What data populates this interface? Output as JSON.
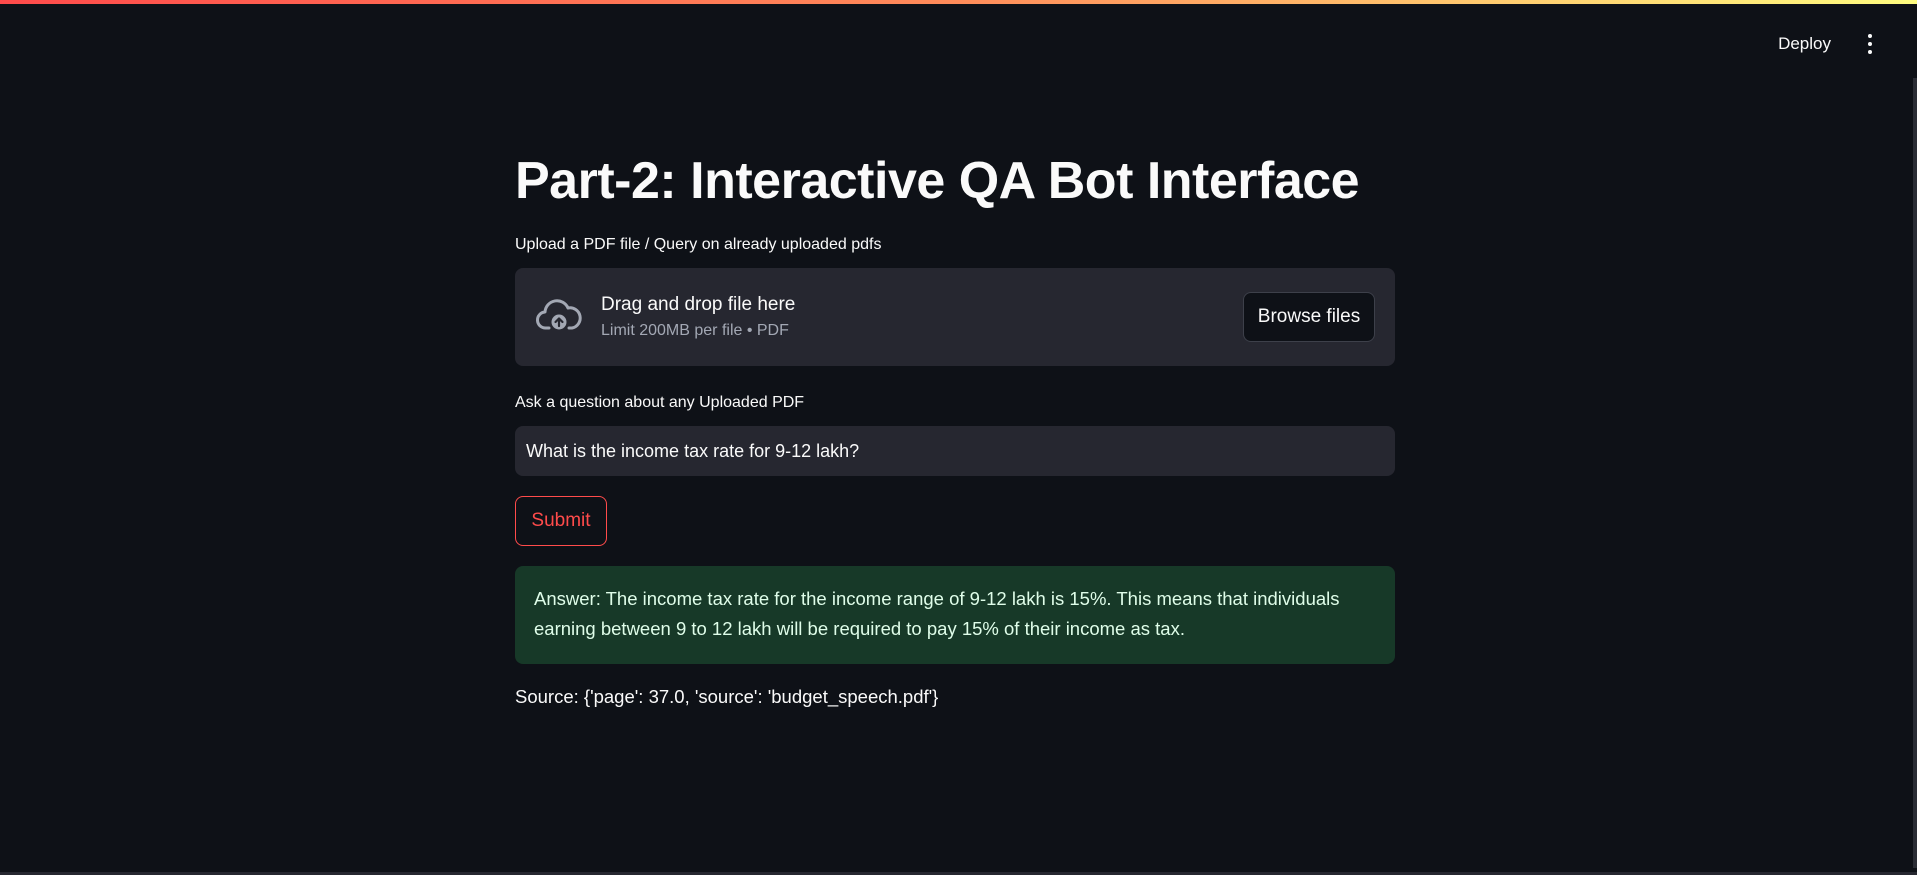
{
  "header": {
    "deploy_label": "Deploy",
    "menu_icon": "kebab-vertical-icon"
  },
  "colors": {
    "background": "#0e1117",
    "surface": "#262730",
    "accent": "#ff4b4b",
    "success_bg": "#173928",
    "success_text": "#dffde9"
  },
  "main": {
    "title": "Part-2: Interactive QA Bot Interface",
    "uploader": {
      "label": "Upload a PDF file / Query on already uploaded pdfs",
      "icon": "cloud-upload-icon",
      "drop_text": "Drag and drop file here",
      "limit_text": "Limit 200MB per file • PDF",
      "browse_label": "Browse files"
    },
    "question": {
      "label": "Ask a question about any Uploaded PDF",
      "value": "What is the income tax rate for 9-12 lakh?"
    },
    "submit_label": "Submit",
    "answer": "Answer: The income tax rate for the income range of 9-12 lakh is 15%. This means that individuals earning between 9 to 12 lakh will be required to pay 15% of their income as tax.",
    "source": "Source: {'page': 37.0, 'source': 'budget_speech.pdf'}"
  }
}
